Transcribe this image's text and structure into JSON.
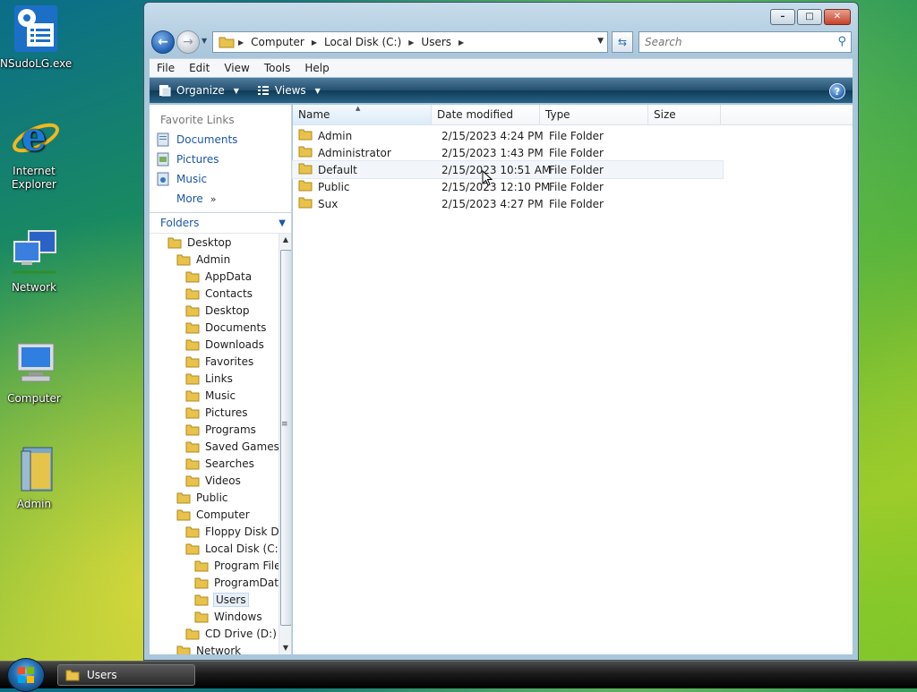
{
  "desktop": {
    "icons": [
      {
        "label": "NSudoLG.exe"
      },
      {
        "label": "Internet Explorer"
      },
      {
        "label": "Network"
      },
      {
        "label": "Computer"
      },
      {
        "label": "Admin"
      }
    ]
  },
  "window": {
    "address": [
      "Computer",
      "Local Disk (C:)",
      "Users"
    ],
    "search_placeholder": "Search",
    "menu": [
      "File",
      "Edit",
      "View",
      "Tools",
      "Help"
    ],
    "toolbar": {
      "organize": "Organize",
      "views": "Views",
      "help": "?"
    },
    "favorites": {
      "title": "Favorite Links",
      "items": [
        "Documents",
        "Pictures",
        "Music"
      ],
      "more": "More"
    },
    "folders_label": "Folders",
    "tree": [
      {
        "label": "Desktop",
        "level": 0
      },
      {
        "label": "Admin",
        "level": 1
      },
      {
        "label": "AppData",
        "level": 2
      },
      {
        "label": "Contacts",
        "level": 2
      },
      {
        "label": "Desktop",
        "level": 2
      },
      {
        "label": "Documents",
        "level": 2
      },
      {
        "label": "Downloads",
        "level": 2
      },
      {
        "label": "Favorites",
        "level": 2
      },
      {
        "label": "Links",
        "level": 2
      },
      {
        "label": "Music",
        "level": 2
      },
      {
        "label": "Pictures",
        "level": 2
      },
      {
        "label": "Programs",
        "level": 2
      },
      {
        "label": "Saved Games",
        "level": 2
      },
      {
        "label": "Searches",
        "level": 2
      },
      {
        "label": "Videos",
        "level": 2
      },
      {
        "label": "Public",
        "level": 1
      },
      {
        "label": "Computer",
        "level": 1
      },
      {
        "label": "Floppy Disk Dr",
        "level": 2
      },
      {
        "label": "Local Disk (C:)",
        "level": 2
      },
      {
        "label": "Program File",
        "level": 3
      },
      {
        "label": "ProgramData",
        "level": 3
      },
      {
        "label": "Users",
        "level": 3,
        "selected": true
      },
      {
        "label": "Windows",
        "level": 3
      },
      {
        "label": "CD Drive (D:) v",
        "level": 2
      },
      {
        "label": "Network",
        "level": 1
      }
    ],
    "columns": [
      "Name",
      "Date modified",
      "Type",
      "Size"
    ],
    "files": [
      {
        "name": "Admin",
        "date": "2/15/2023 4:24 PM",
        "type": "File Folder",
        "size": ""
      },
      {
        "name": "Administrator",
        "date": "2/15/2023 1:43 PM",
        "type": "File Folder",
        "size": ""
      },
      {
        "name": "Default",
        "date": "2/15/2023 10:51 AM",
        "type": "File Folder",
        "size": ""
      },
      {
        "name": "Public",
        "date": "2/15/2023 12:10 PM",
        "type": "File Folder",
        "size": ""
      },
      {
        "name": "Sux",
        "date": "2/15/2023 4:27 PM",
        "type": "File Folder",
        "size": ""
      }
    ]
  },
  "taskbar": {
    "task": "Users"
  }
}
